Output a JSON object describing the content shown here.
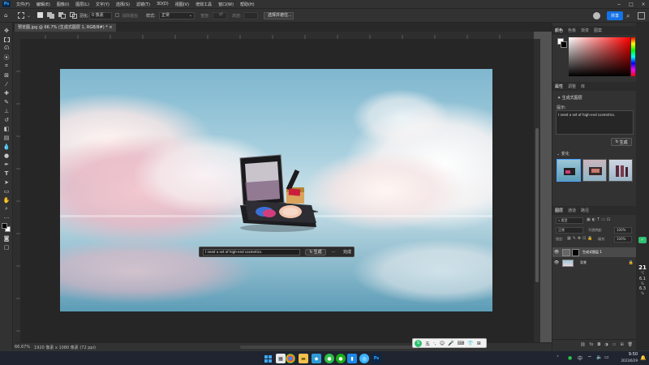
{
  "menu": {
    "items": [
      "文件(F)",
      "编辑(E)",
      "图像(I)",
      "图层(L)",
      "文字(Y)",
      "选择(S)",
      "滤镜(T)",
      "3D(D)",
      "视图(V)",
      "增效工具",
      "窗口(W)",
      "帮助(H)"
    ],
    "app_badge": "Ps"
  },
  "options": {
    "feather_label": "羽化:",
    "feather_value": "0 像素",
    "antialias_label": "消除锯齿",
    "style_label": "样式:",
    "style_value": "正常",
    "width_label": "宽度:",
    "height_label": "高度:",
    "select_mask_button": "选择并遮住...",
    "share_button": "共享"
  },
  "document": {
    "tab_title": "预览图.jpg @ 66.7% (生成式图层 1, RGB/8#) *"
  },
  "contextbar": {
    "prompt_value": "I need a set of high-end cosmetics.",
    "generate_label": "生成",
    "more_label": "···",
    "done_label": "完成"
  },
  "status": {
    "zoom": "66.67%",
    "doc_info": "1920 像素 x 1080 像素 (72 ppi)"
  },
  "color_panel": {
    "tabs": [
      "颜色",
      "色板",
      "渐变",
      "图案"
    ]
  },
  "properties_panel": {
    "tabs": [
      "属性",
      "调整",
      "库"
    ],
    "layer_type": "生成式图层",
    "prompt_label": "提示:",
    "prompt_value": "I need a set of high-end cosmetics.",
    "generate_label": "生成",
    "variations_label": "变化"
  },
  "layers_panel": {
    "tabs": [
      "图层",
      "通道",
      "路径"
    ],
    "kind_label": "类型",
    "blend_mode": "正常",
    "opacity_label": "不透明度:",
    "opacity_value": "100%",
    "lock_label": "锁定:",
    "fill_label": "填充:",
    "fill_value": "100%",
    "layers": [
      {
        "name": "生成式图层 1"
      },
      {
        "name": "背景"
      }
    ]
  },
  "side_readouts": {
    "temp": "21",
    "temp_unit": "°C",
    "v1": "6.1",
    "v1_unit": "%",
    "v2": "6.3",
    "v2_unit": "%"
  },
  "ime_bar": {
    "label": "五"
  },
  "taskbar": {
    "time": "9:50",
    "date": "2023/6/29"
  }
}
